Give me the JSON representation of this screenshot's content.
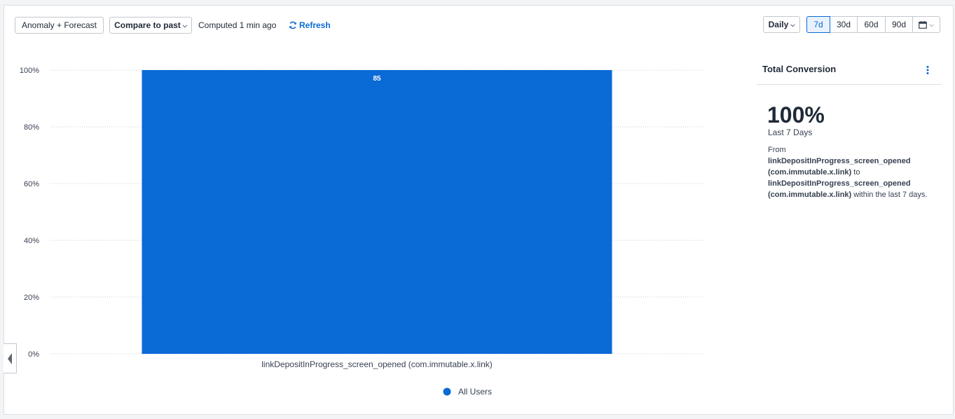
{
  "toolbar": {
    "anomaly_label": "Anomaly + Forecast",
    "compare_label": "Compare to past",
    "computed_text": "Computed 1 min ago",
    "refresh_label": "Refresh",
    "interval_label": "Daily",
    "ranges": [
      "7d",
      "30d",
      "60d",
      "90d"
    ],
    "active_range": "7d"
  },
  "sidebar": {
    "title": "Total Conversion",
    "value": "100%",
    "period": "Last 7 Days",
    "desc_from": "From",
    "desc_event1": "linkDepositInProgress_screen_opened (com.immutable.x.link)",
    "desc_to": "to",
    "desc_event2": "linkDepositInProgress_screen_opened (com.immutable.x.link)",
    "desc_suffix": "within the last 7 days."
  },
  "colors": {
    "bar": "#0a6ad6",
    "accent": "#0a6ad6"
  },
  "icons": {
    "refresh": "refresh-icon",
    "calendar": "calendar-icon",
    "kebab": "kebab-menu-icon",
    "collapse": "caret-left-icon"
  },
  "chart_data": {
    "type": "bar",
    "categories": [
      "linkDepositInProgress_screen_opened (com.immutable.x.link)"
    ],
    "series": [
      {
        "name": "All Users",
        "values": [
          100
        ],
        "labels": [
          "85"
        ]
      }
    ],
    "yticks": [
      "0%",
      "20%",
      "40%",
      "60%",
      "80%",
      "100%"
    ],
    "ylim": [
      0,
      100
    ],
    "grid": true,
    "legend": "bottom"
  }
}
